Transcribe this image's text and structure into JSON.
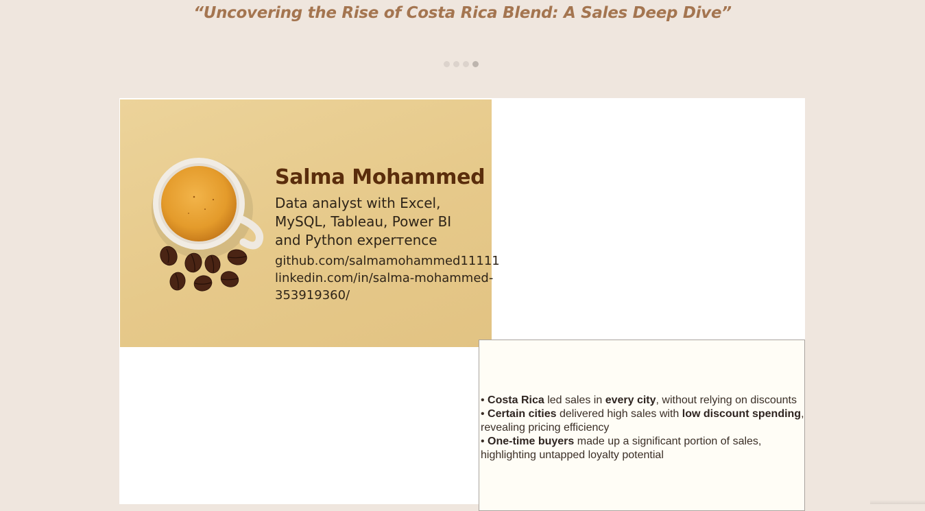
{
  "header": {
    "title": "“Uncovering the Rise of Costa Rica Blend: A Sales Deep Dive”"
  },
  "pagination": {
    "total": 4,
    "active_index": 4
  },
  "profile": {
    "name": "Salma Mohammed",
    "tagline_lines": [
      "Data analyst with Excel,",
      "MySQL, Tableau, Power BI",
      "and Python experтence"
    ],
    "github": "github.com/salmamohammed11111",
    "linkedin_line1": "linkedin.com/in/salma-mohammed-",
    "linkedin_line2": "353919360/"
  },
  "insights": {
    "items": [
      {
        "parts": [
          {
            "b": "Costa Rica"
          },
          {
            "t": " led sales in "
          },
          {
            "b": "every city"
          },
          {
            "t": ", without relying on discounts"
          }
        ]
      },
      {
        "parts": [
          {
            "b": "Certain cities"
          },
          {
            "t": " delivered high sales with "
          },
          {
            "b": "low discount spending"
          },
          {
            "t": ", revealing pricing efficiency"
          }
        ]
      },
      {
        "parts": [
          {
            "b": "One-time buyers"
          },
          {
            "t": " made up a significant portion of sales, highlighting untapped loyalty potential"
          }
        ]
      }
    ]
  },
  "colors": {
    "background": "#efe6de",
    "title": "#a47550",
    "card_gold": "#e6c98a",
    "name_brown": "#5a2d0c"
  },
  "icons": [
    "coffee-cup-image",
    "coffee-bean-icon"
  ]
}
